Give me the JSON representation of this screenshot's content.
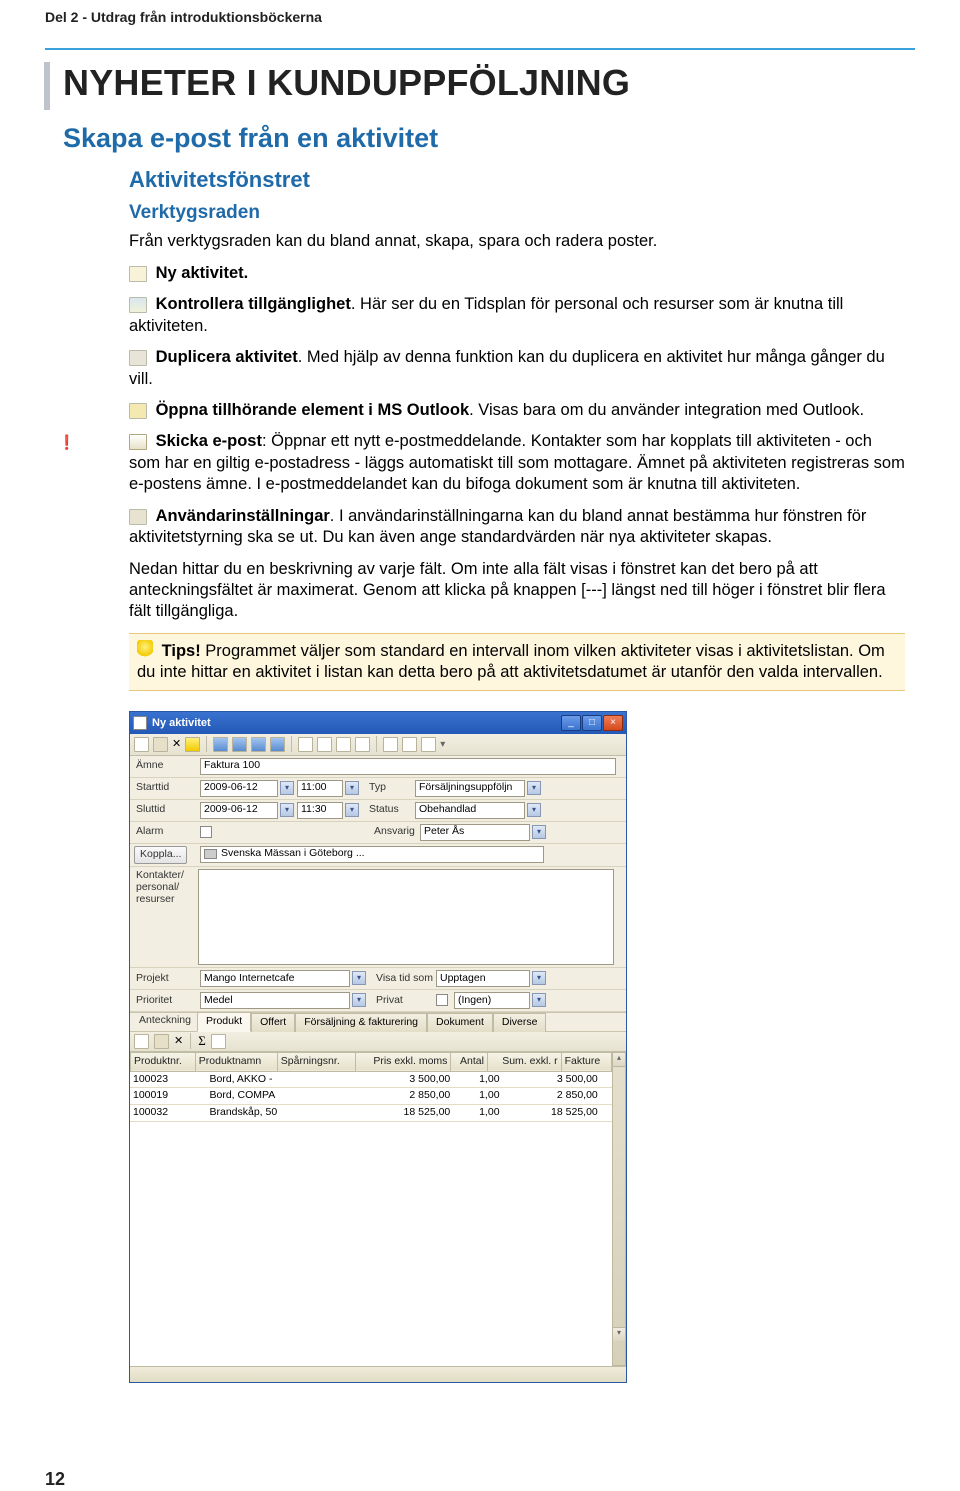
{
  "header": "Del 2 - Utdrag från introduktionsböckerna",
  "h1": "NYHETER I KUNDUPPFÖLJNING",
  "h2": "Skapa e-post från en aktivitet",
  "h3": "Aktivitetsfönstret",
  "h4": "Verktygsraden",
  "intro": "Från verktygsraden kan du bland annat, skapa, spara och radera poster.",
  "items": {
    "ny": "Ny aktivitet.",
    "kontrollera_b": "Kontrollera tillgänglighet",
    "kontrollera": ". Här ser du en Tidsplan för personal och resurser som är knutna till aktiviteten.",
    "duplicera_b": "Duplicera aktivitet",
    "duplicera": ". Med hjälp av denna funktion kan du duplicera en aktivitet hur många gånger du vill.",
    "outlook_b": "Öppna tillhörande element i MS Outlook",
    "outlook": ". Visas bara om du använder integration med Outlook.",
    "mail_b": "Skicka e-post",
    "mail": ": Öppnar ett nytt e-postmeddelande. Kontakter som har kopplats till aktiviteten - och som har en giltig e-postadress - läggs automatiskt till som mottagare. Ämnet på aktiviteten registreras som e-postens ämne. I e-postmeddelandet kan du bifoga dokument som är knutna till aktiviteten.",
    "anv_b": "Användarinställningar",
    "anv": ". I användarinställningarna kan du bland annat bestämma hur fönstren för aktivitetstyrning ska se ut. Du kan även ange standardvärden när nya aktiviteter skapas."
  },
  "para2": "Nedan hittar du en beskrivning av varje fält. Om inte alla fält visas i fönstret kan det bero på att anteckningsfältet är maximerat. Genom att klicka på knappen [---] längst ned till höger i fönstret blir flera fält tillgängliga.",
  "tips_b": "Tips!",
  "tips": " Programmet väljer som standard en intervall inom vilken aktiviteter visas i aktivitetslistan. Om du inte hittar en aktivitet i listan kan detta bero på att aktivitetsdatumet är utanför den valda intervallen.",
  "page_num": "12",
  "shot": {
    "title": "Ny aktivitet",
    "labels": {
      "amne": "Ämne",
      "starttid": "Starttid",
      "sluttid": "Sluttid",
      "alarm": "Alarm",
      "koppla": "Koppla...",
      "kontakter": "Kontakter/\npersonal/\nresurser",
      "typ": "Typ",
      "status": "Status",
      "ansvarig": "Ansvarig",
      "projekt": "Projekt",
      "prioritet": "Prioritet",
      "visa": "Visa tid som",
      "privat": "Privat",
      "anteckning": "Anteckning"
    },
    "values": {
      "amne": "Faktura 100",
      "startdate": "2009-06-12",
      "starttime": "11:00",
      "slutdate": "2009-06-12",
      "sluttime": "11:30",
      "typ": "Försäljningsuppföljn",
      "status": "Obehandlad",
      "ansvarig": "Peter Ås",
      "kopplad": "Svenska Mässan i Göteborg ...",
      "projekt": "Mango Internetcafe",
      "prioritet": "Medel",
      "visa": "Upptagen",
      "privat": "(Ingen)"
    },
    "tabs": [
      "Produkt",
      "Offert",
      "Försäljning & fakturering",
      "Dokument",
      "Diverse"
    ],
    "active_tab": 0,
    "table": {
      "headers": [
        "Produktnr.",
        "Produktnamn",
        "Spårningsnr.",
        "Pris exkl. moms",
        "Antal",
        "Sum. exkl. r",
        "Fakture"
      ],
      "rows": [
        {
          "nr": "100023",
          "namn": "Bord, AKKO -",
          "spar": "",
          "pris": "3 500,00",
          "antal": "1,00",
          "sum": "3 500,00",
          "fak": ""
        },
        {
          "nr": "100019",
          "namn": "Bord, COMPA",
          "spar": "",
          "pris": "2 850,00",
          "antal": "1,00",
          "sum": "2 850,00",
          "fak": ""
        },
        {
          "nr": "100032",
          "namn": "Brandskåp, 50",
          "spar": "",
          "pris": "18 525,00",
          "antal": "1,00",
          "sum": "18 525,00",
          "fak": ""
        }
      ]
    }
  }
}
